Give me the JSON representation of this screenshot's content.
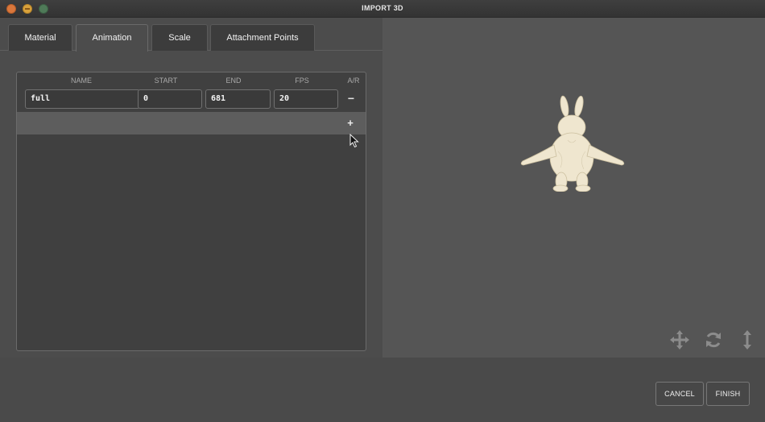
{
  "window": {
    "title": "IMPORT 3D"
  },
  "tabs": [
    {
      "label": "Material",
      "active": false
    },
    {
      "label": "Animation",
      "active": true
    },
    {
      "label": "Scale",
      "active": false
    },
    {
      "label": "Attachment Points",
      "active": false
    }
  ],
  "animation_table": {
    "columns": [
      "NAME",
      "START",
      "END",
      "FPS",
      "A/R"
    ],
    "rows": [
      {
        "name": "full",
        "start": "0",
        "end": "681",
        "fps": "20",
        "action": "−"
      }
    ],
    "add_label": "+"
  },
  "viewer": {
    "tools": [
      "move-icon",
      "rotate-icon",
      "scale-vertical-icon"
    ],
    "background": "#555555"
  },
  "footer": {
    "cancel_label": "CANCEL",
    "finish_label": "FINISH"
  }
}
